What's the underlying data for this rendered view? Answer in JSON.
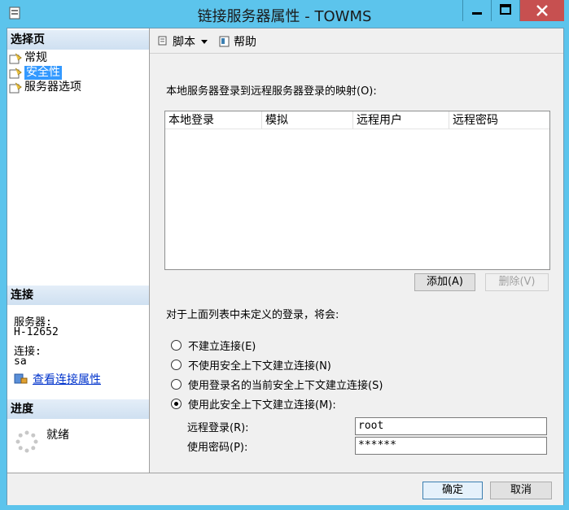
{
  "window": {
    "title": "链接服务器属性 - TOWMS"
  },
  "left": {
    "select_page_title": "选择页",
    "pages": [
      "常规",
      "安全性",
      "服务器选项"
    ],
    "connection_title": "连接",
    "server_label": "服务器:",
    "server_value": "H-12652",
    "connection_label": "连接:",
    "connection_value": "sa",
    "view_props_link": "查看连接属性",
    "progress_title": "进度",
    "progress_status": "就绪"
  },
  "toolbar": {
    "script": "脚本",
    "help": "帮助"
  },
  "main": {
    "mapping_label": "本地服务器登录到远程服务器登录的映射(O):",
    "grid_columns": [
      "本地登录",
      "模拟",
      "远程用户",
      "远程密码"
    ],
    "add_button": "添加(A)",
    "remove_button": "删除(V)",
    "undefined_label": "对于上面列表中未定义的登录，将会:",
    "options": [
      "不建立连接(E)",
      "不使用安全上下文建立连接(N)",
      "使用登录名的当前安全上下文建立连接(S)",
      "使用此安全上下文建立连接(M):"
    ],
    "selected_option": 3,
    "remote_login_label": "远程登录(R):",
    "remote_login_value": "root",
    "password_label": "使用密码(P):",
    "password_value": "******"
  },
  "footer": {
    "ok": "确定",
    "cancel": "取消"
  }
}
